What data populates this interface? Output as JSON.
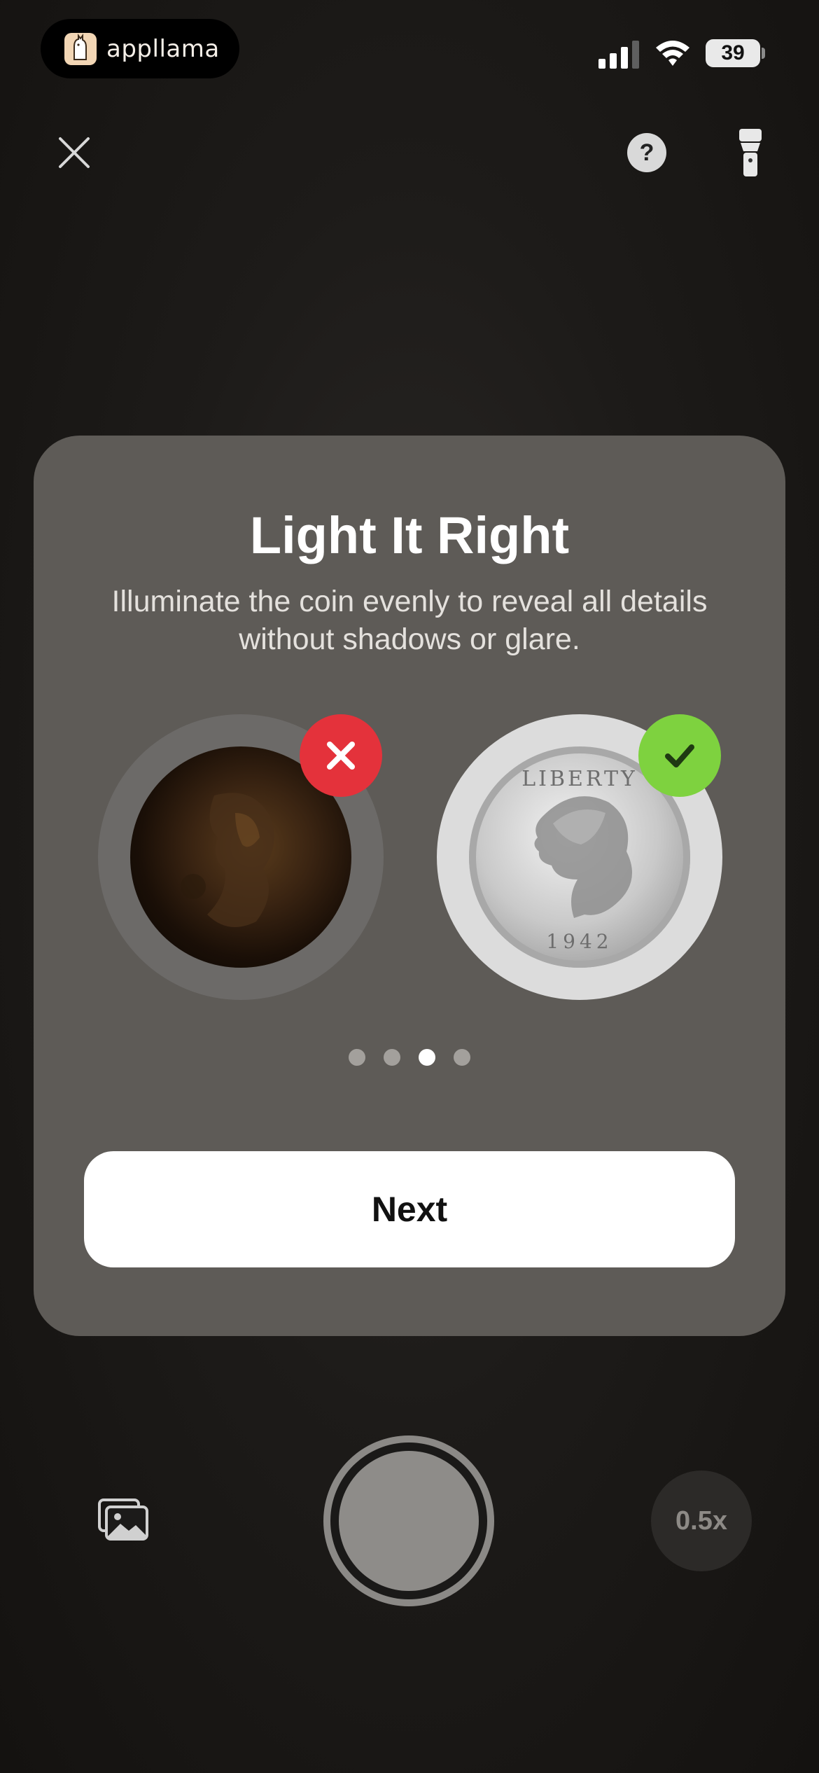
{
  "status_bar": {
    "app_name": "appllama",
    "battery_level": "39",
    "icons": [
      "signal-icon",
      "wifi-icon",
      "battery-icon"
    ]
  },
  "top_controls": {
    "close_icon": "close-icon",
    "help_label": "?",
    "flashlight_icon": "flashlight-icon"
  },
  "modal": {
    "title": "Light It Right",
    "description": "Illuminate the coin evenly to reveal all details without shadows or glare.",
    "examples": [
      {
        "status": "incorrect",
        "badge_icon": "x-icon",
        "badge_color": "#e4323b"
      },
      {
        "status": "correct",
        "badge_icon": "checkmark-icon",
        "badge_color": "#7ed23f"
      }
    ],
    "pagination": {
      "total": 4,
      "current": 3
    },
    "next_label": "Next"
  },
  "bottom_controls": {
    "gallery_icon": "photo-gallery-icon",
    "shutter_icon": "shutter-button",
    "zoom_label": "0.5x"
  },
  "colors": {
    "card_background": "#5e5b57",
    "incorrect_red": "#e4323b",
    "correct_green": "#7ed23f"
  }
}
